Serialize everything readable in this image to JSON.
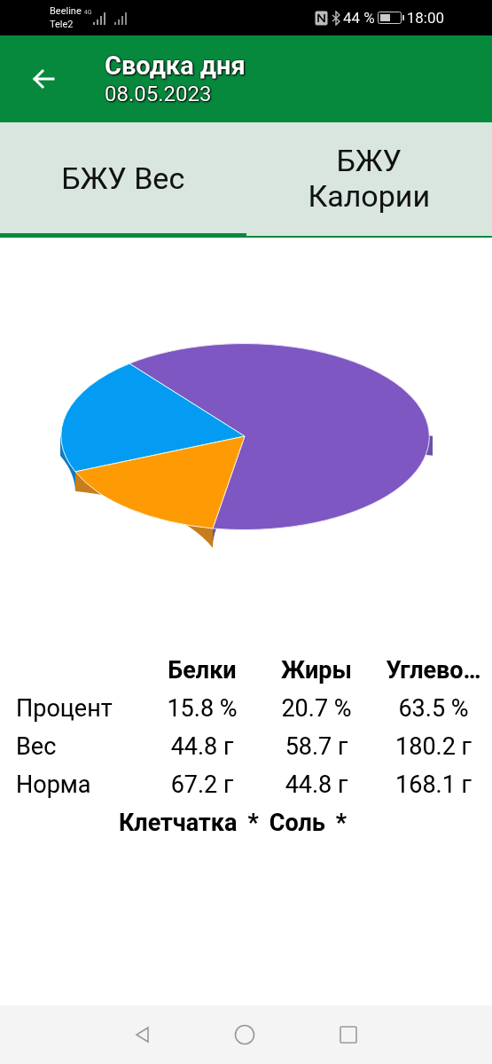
{
  "status_bar": {
    "carriers": [
      "Beeline",
      "Tele2"
    ],
    "network": "4G",
    "battery": "44 %",
    "time": "18:00"
  },
  "header": {
    "title": "Сводка дня",
    "subtitle": "08.05.2023"
  },
  "tabs": [
    {
      "label": "БЖУ Вес",
      "selected": true
    },
    {
      "label": "БЖУ Калории",
      "selected": false
    }
  ],
  "summary": {
    "columns": [
      "Белки",
      "Жиры",
      "Углево…"
    ],
    "rows": [
      {
        "label": "Процент",
        "values": [
          "15.8 %",
          "20.7 %",
          "63.5 %"
        ]
      },
      {
        "label": "Вес",
        "values": [
          "44.8 г",
          "58.7 г",
          "180.2 г"
        ]
      },
      {
        "label": "Норма",
        "values": [
          "67.2 г",
          "44.8 г",
          "168.1 г"
        ]
      }
    ],
    "footer": [
      {
        "label": "Клетчатка",
        "value": "*"
      },
      {
        "label": "Соль",
        "value": "*"
      }
    ]
  }
}
